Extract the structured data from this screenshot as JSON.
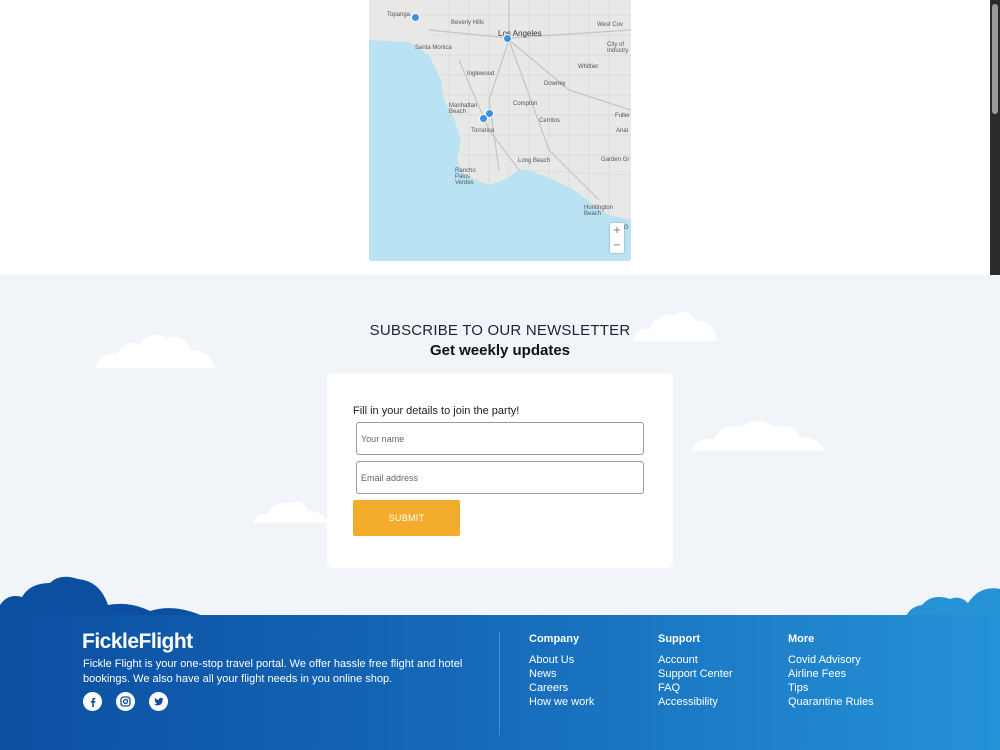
{
  "map": {
    "labels": {
      "topanga": "Topanga",
      "beverly_hills": "Beverly Hills",
      "los_angeles": "Los Angeles",
      "west_covina": "West Cov",
      "santa_monica": "Santa Monica",
      "city_of_industry": "City of Industry",
      "whittier": "Whittier",
      "inglewood": "Inglewood",
      "downey": "Downey",
      "manhattan_beach": "Manhattan Beach",
      "compton": "Compton",
      "fullerton": "Fuller",
      "cerritos": "Cerritos",
      "anaheim": "Anal",
      "torrance": "Torrance",
      "long_beach": "Long Beach",
      "garden_grove": "Garden Gr",
      "rancho_palos_verdes": "Rancho Palos Verdes",
      "huntington_beach": "Huntington Beach",
      "edge_label": "G"
    },
    "zoom_in": "+",
    "zoom_out": "−"
  },
  "newsletter": {
    "title": "SUBSCRIBE TO OUR NEWSLETTER",
    "subtitle": "Get weekly updates",
    "intro": "Fill in your details to join the party!",
    "name_placeholder": "Your name",
    "email_placeholder": "Email address",
    "submit_label": "SUBMIT"
  },
  "footer": {
    "brand": "FickleFlight",
    "description": "Fickle Flight is your one-stop travel portal. We offer hassle free flight and hotel bookings. We also have all your flight needs in you online shop.",
    "socials": [
      "facebook-icon",
      "instagram-icon",
      "twitter-icon"
    ],
    "columns": [
      {
        "title": "Company",
        "links": [
          "About Us",
          "News",
          "Careers",
          "How we work"
        ]
      },
      {
        "title": "Support",
        "links": [
          "Account",
          "Support Center",
          "FAQ",
          "Accessibility"
        ]
      },
      {
        "title": "More",
        "links": [
          "Covid Advisory",
          "Airline Fees",
          "Tips",
          "Quarantine Rules"
        ]
      }
    ]
  },
  "colors": {
    "accent": "#f3ab2b",
    "footer_dark": "#0c4fa1",
    "footer_light": "#2592d6",
    "marker": "#3d8fe6",
    "water": "#b9e2f2"
  }
}
